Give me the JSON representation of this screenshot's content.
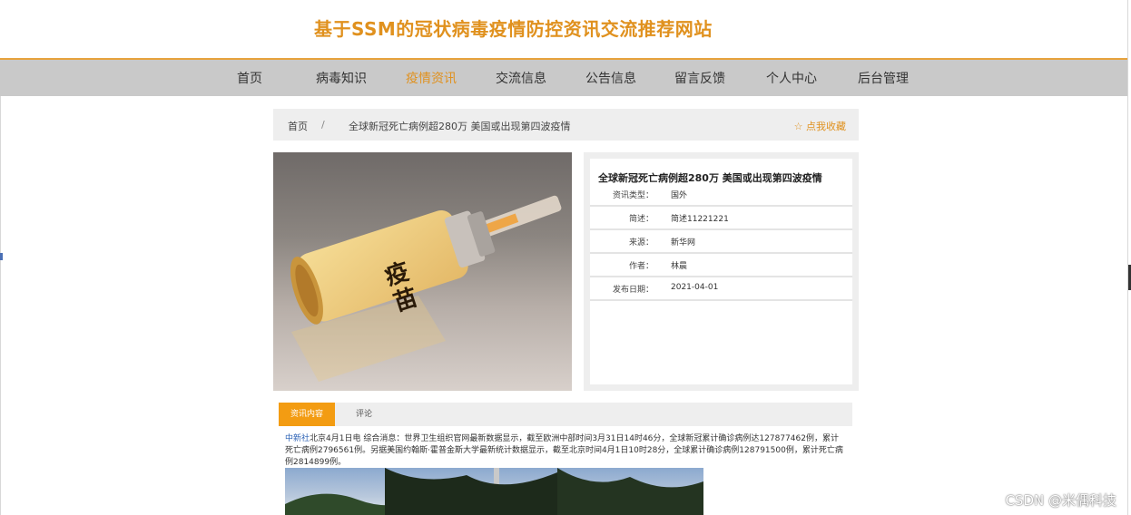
{
  "site": {
    "title": "基于SSM的冠状病毒疫情防控资讯交流推荐网站"
  },
  "nav": {
    "items": [
      {
        "label": "首页"
      },
      {
        "label": "病毒知识"
      },
      {
        "label": "疫情资讯"
      },
      {
        "label": "交流信息"
      },
      {
        "label": "公告信息"
      },
      {
        "label": "留言反馈"
      },
      {
        "label": "个人中心"
      },
      {
        "label": "后台管理"
      }
    ],
    "active": "疫情资讯"
  },
  "breadcrumb": {
    "home": "首页",
    "separator": "/",
    "current": "全球新冠死亡病例超280万 美国或出现第四波疫情",
    "favorite": "☆ 点我收藏"
  },
  "image": {
    "label_text": "疫苗"
  },
  "detail": {
    "title": "全球新冠死亡病例超280万 美国或出现第四波疫情",
    "rows": [
      {
        "label": "资讯类型：",
        "value": "国外"
      },
      {
        "label": "简述：",
        "value": "简述11221221"
      },
      {
        "label": "来源：",
        "value": "新华网"
      },
      {
        "label": "作者：",
        "value": "林晨"
      },
      {
        "label": "发布日期：",
        "value": "2021-04-01"
      }
    ]
  },
  "tabs": [
    {
      "label": "资讯内容"
    },
    {
      "label": "评论"
    }
  ],
  "article": {
    "source": "中新社",
    "text": "北京4月1日电 综合消息：世界卫生组织官网最新数据显示，截至欧洲中部时间3月31日14时46分，全球新冠累计确诊病例达127877462例，累计死亡病例2796561例。另据美国约翰斯·霍普金斯大学最新统计数据显示，截至北京时间4月1日10时28分，全球累计确诊病例128791500例，累计死亡病例2814899例。"
  },
  "watermark": "CSDN @米偶科技",
  "colors": {
    "accent": "#e0911e",
    "tab_active": "#f39c12",
    "nav_bg": "#c9c9c9",
    "link": "#2c62b5"
  }
}
